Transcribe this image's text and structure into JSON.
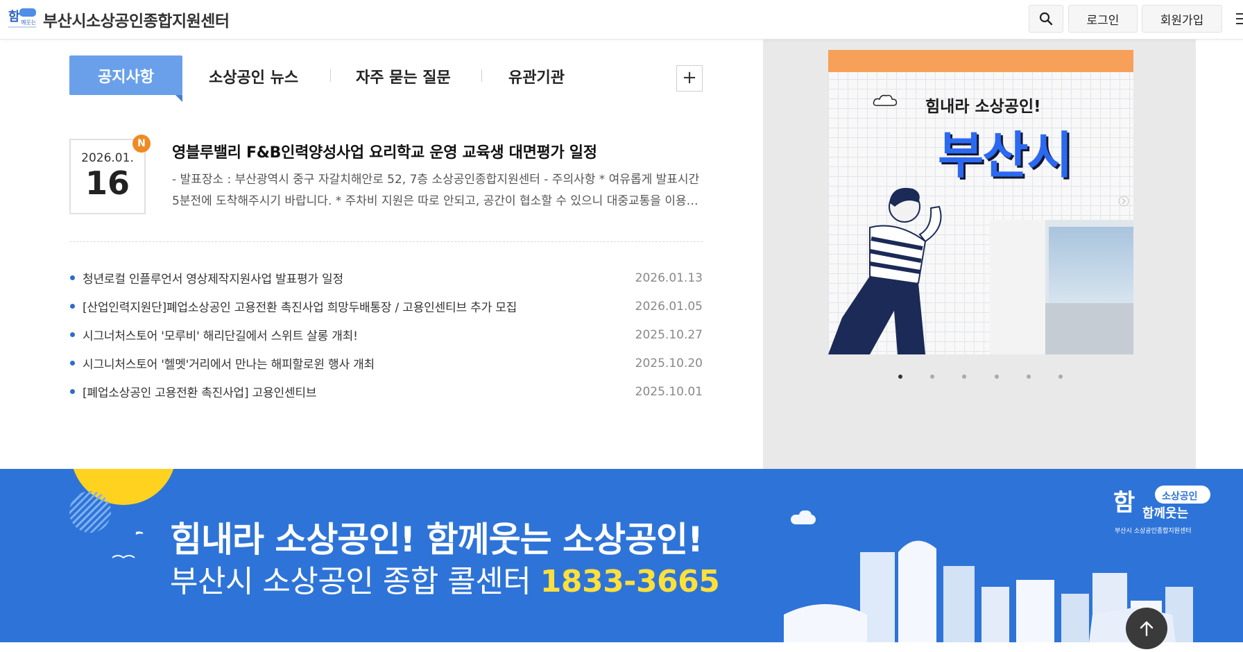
{
  "header": {
    "site_title": "부산시소상공인종합지원센터",
    "logo_text": "함께웃는",
    "search_icon": "search-icon",
    "login_label": "로그인",
    "join_label": "회원가입",
    "menu_icon": "hamburger-menu-icon"
  },
  "tabs": [
    {
      "label": "공지사항",
      "active": true
    },
    {
      "label": "소상공인 뉴스",
      "active": false
    },
    {
      "label": "자주 묻는 질문",
      "active": false
    },
    {
      "label": "유관기관",
      "active": false
    }
  ],
  "more_label": "+",
  "featured": {
    "date_ym": "2026.01.",
    "date_d": "16",
    "badge": "N",
    "title": "영블루밸리 F&B인력양성사업 요리학교 운영 교육생 대면평가 일정",
    "desc": "  - 발표장소 : 부산광역시 중구 자갈치해안로 52, 7층 소상공인종합지원센터    - 주의사항     * 여유롭게 발표시간 5분전에 도착해주시기 바랍니다.    * 주차비 지원은 따로 안되고, 공간이 협소할 수 있으니 대중교통을 이용해주시기 바랍니다."
  },
  "notices": [
    {
      "title": "청년로컬 인플루언서 영상제작지원사업 발표평가 일정",
      "date": "2026.01.13"
    },
    {
      "title": "[산업인력지원단]폐업소상공인 고용전환 촉진사업 희망두배통장 / 고용인센티브 추가 모집",
      "date": "2026.01.05"
    },
    {
      "title": "시그너처스토어 '모루비' 해리단길에서 스위트 살롱 개최!",
      "date": "2025.10.27"
    },
    {
      "title": "시그니처스토어 '헬멧'거리에서 만나는 해피할로윈 행사 개최",
      "date": "2025.10.20"
    },
    {
      "title": "[폐업소상공인 고용전환 촉진사업] 고용인센티브",
      "date": "2025.10.01"
    }
  ],
  "poster": {
    "subtitle": "힘내라 소상공인!",
    "city": "부산시",
    "dot_count": 6,
    "active_dot": 0
  },
  "banner": {
    "line1": "힘내라 소상공인!  함께웃는 소상공인!",
    "line2": "부산시 소상공인 종합 콜센터 ",
    "phone": "1833-3665",
    "logo_line1": "소상공인",
    "logo_line2": "함께웃는",
    "logo_caption": "부산시 소상공인종합지원센터"
  },
  "colors": {
    "accent": "#6aa0ea",
    "banner": "#2e74d8",
    "badge": "#f08a24",
    "phone": "#ffe03b"
  },
  "scroll_top_icon": "arrow-up-icon"
}
